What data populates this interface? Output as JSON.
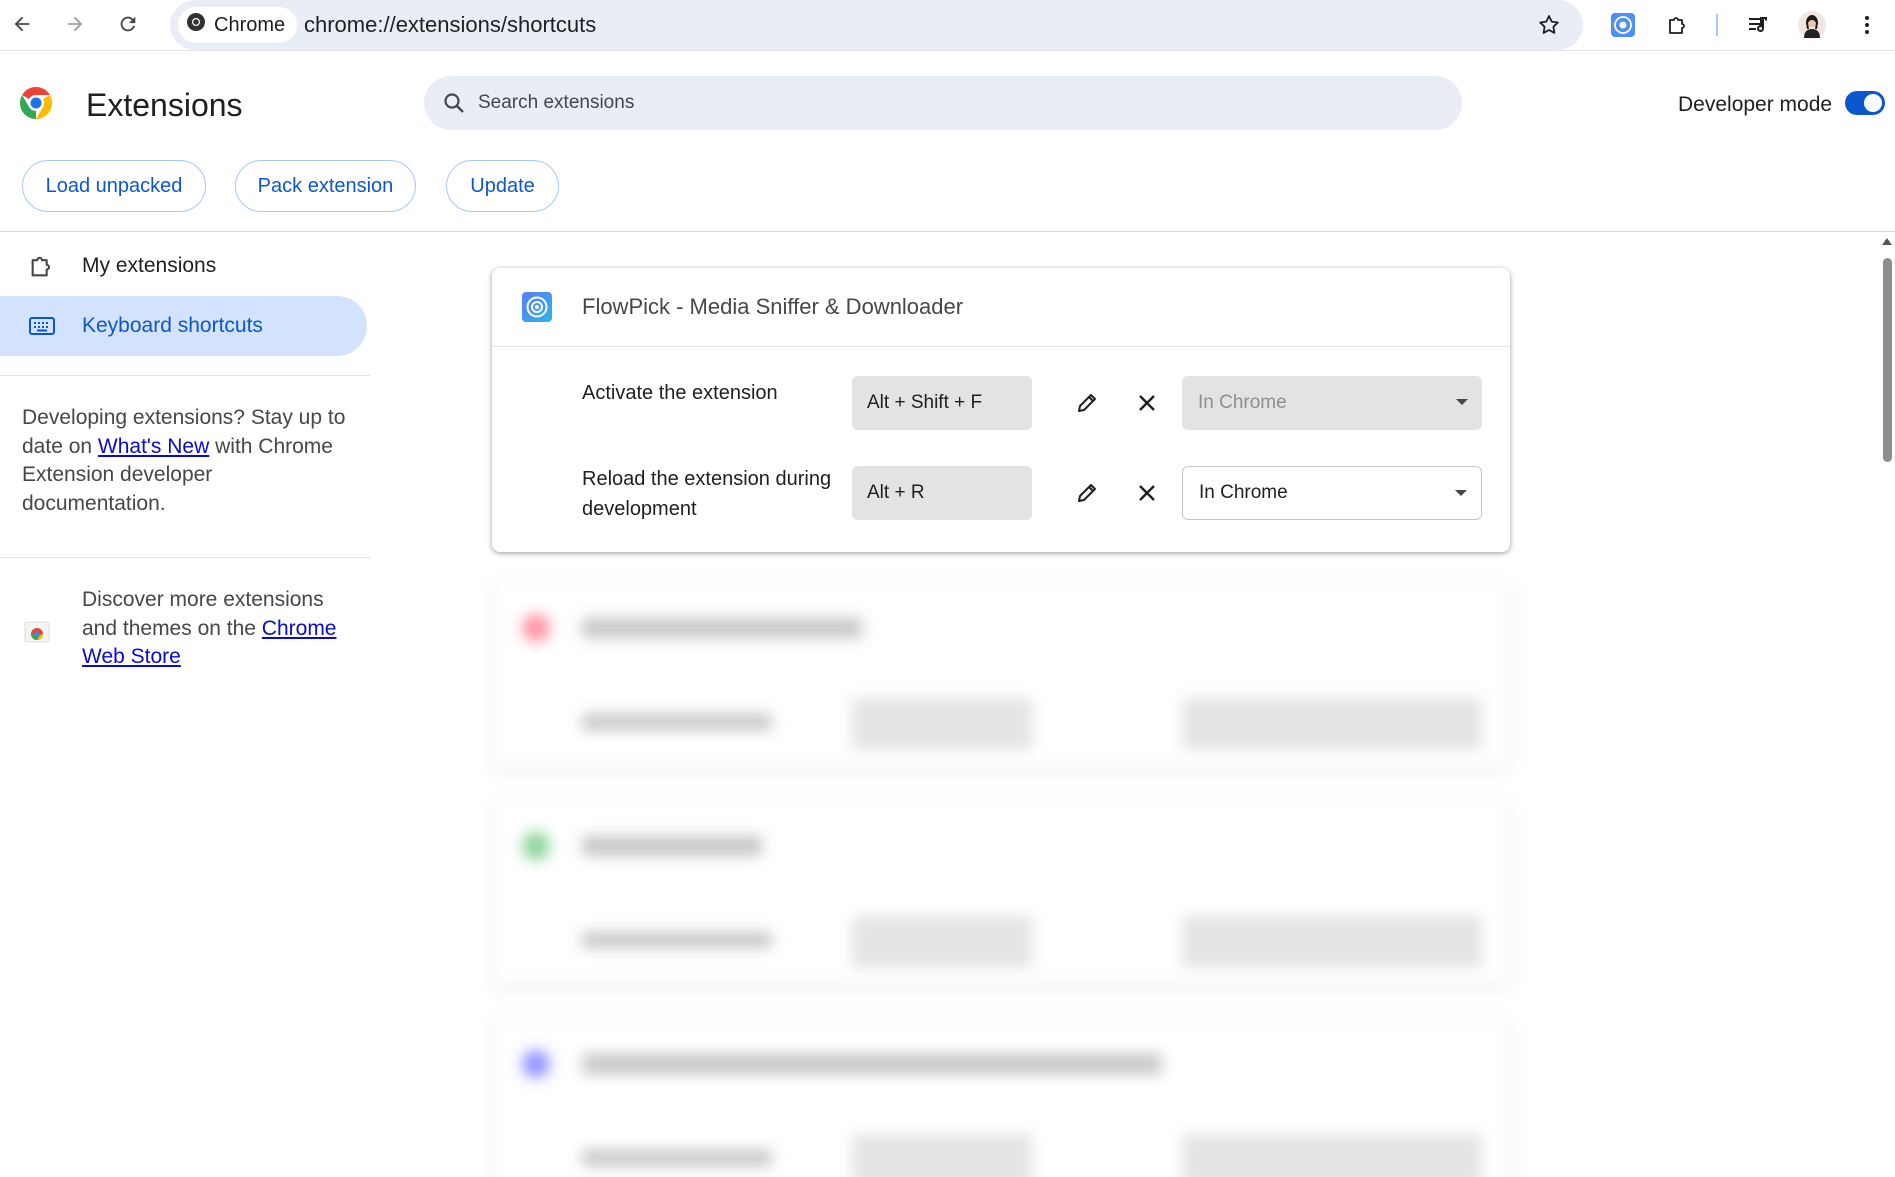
{
  "browser": {
    "chip_label": "Chrome",
    "url": "chrome://extensions/shortcuts"
  },
  "header": {
    "title": "Extensions",
    "search_placeholder": "Search extensions",
    "developer_mode_label": "Developer mode",
    "developer_mode_on": true,
    "buttons": {
      "load_unpacked": "Load unpacked",
      "pack_extension": "Pack extension",
      "update": "Update"
    }
  },
  "sidebar": {
    "items": [
      {
        "label": "My extensions",
        "icon": "extension-puzzle-icon",
        "active": false
      },
      {
        "label": "Keyboard shortcuts",
        "icon": "keyboard-icon",
        "active": true
      }
    ],
    "dev_text": {
      "pre": "Developing extensions? Stay up to date on ",
      "link": "What's New",
      "post": " with Chrome Extension developer documentation."
    },
    "store_text": {
      "pre": "Discover more extensions and themes on the ",
      "link": "Chrome Web Store"
    }
  },
  "extensions": [
    {
      "name": "FlowPick - Media Sniffer & Downloader",
      "accent": "#3b6ff2",
      "shortcuts": [
        {
          "label": "Activate the extension",
          "keys": "Alt + Shift + F",
          "scope": "In Chrome",
          "scope_enabled": false
        },
        {
          "label": "Reload the extension during development",
          "keys": "Alt + R",
          "scope": "In Chrome",
          "scope_enabled": true
        }
      ]
    }
  ],
  "colors": {
    "accent": "#0b57d0",
    "active_bg": "#d3e3fd"
  }
}
